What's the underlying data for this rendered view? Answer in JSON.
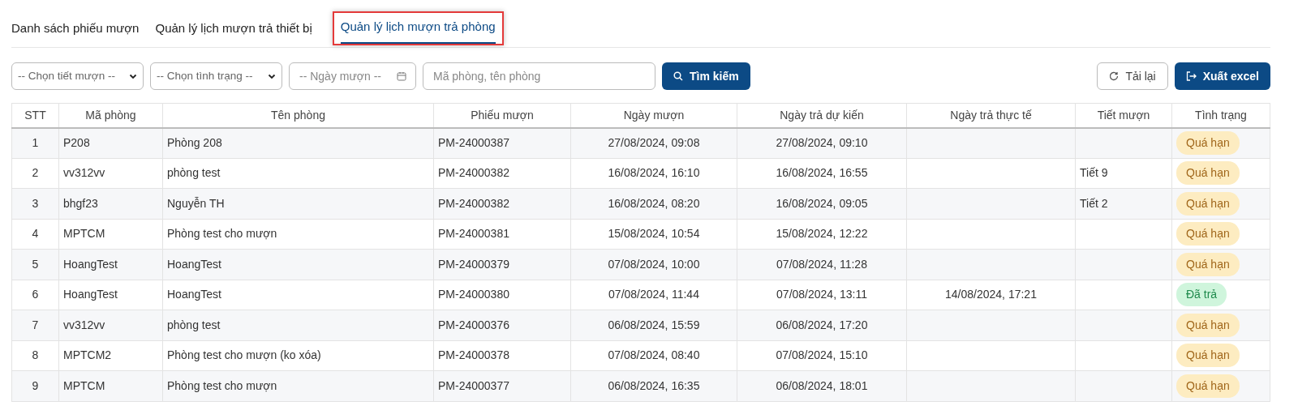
{
  "tabs": [
    {
      "label": "Danh sách phiếu mượn",
      "selected": false
    },
    {
      "label": "Quản lý lịch mượn trả thiết bị",
      "selected": false
    },
    {
      "label": "Quản lý lịch mượn trả phòng",
      "selected": true
    }
  ],
  "filters": {
    "period_select": "-- Chọn tiết mượn --",
    "status_select": "-- Chọn tình trạng --",
    "date_field": {
      "placeholder": "-- Ngày mượn --"
    },
    "search_field": {
      "placeholder": "Mã phòng, tên phòng"
    },
    "search_button": "Tìm kiếm"
  },
  "actions": {
    "reload_button": "Tải lại",
    "export_button": "Xuất excel"
  },
  "table": {
    "columns": [
      "STT",
      "Mã phòng",
      "Tên phòng",
      "Phiếu mượn",
      "Ngày mượn",
      "Ngày trả dự kiến",
      "Ngày trả thực tế",
      "Tiết mượn",
      "Tình trạng"
    ],
    "rows": [
      {
        "stt": "1",
        "code": "P208",
        "name": "Phòng 208",
        "ticket": "PM-24000387",
        "borrowed": "27/08/2024, 09:08",
        "due": "27/08/2024, 09:10",
        "returned": "",
        "period": "",
        "status": {
          "label": "Quá hạn",
          "kind": "overdue"
        }
      },
      {
        "stt": "2",
        "code": "vv312vv",
        "name": "phòng test",
        "ticket": "PM-24000382",
        "borrowed": "16/08/2024, 16:10",
        "due": "16/08/2024, 16:55",
        "returned": "",
        "period": "Tiết 9",
        "status": {
          "label": "Quá hạn",
          "kind": "overdue"
        }
      },
      {
        "stt": "3",
        "code": "bhgf23",
        "name": "Nguyễn TH",
        "ticket": "PM-24000382",
        "borrowed": "16/08/2024, 08:20",
        "due": "16/08/2024, 09:05",
        "returned": "",
        "period": "Tiết 2",
        "status": {
          "label": "Quá hạn",
          "kind": "overdue"
        }
      },
      {
        "stt": "4",
        "code": "MPTCM",
        "name": "Phòng test cho mượn",
        "ticket": "PM-24000381",
        "borrowed": "15/08/2024, 10:54",
        "due": "15/08/2024, 12:22",
        "returned": "",
        "period": "",
        "status": {
          "label": "Quá hạn",
          "kind": "overdue"
        }
      },
      {
        "stt": "5",
        "code": "HoangTest",
        "name": "HoangTest",
        "ticket": "PM-24000379",
        "borrowed": "07/08/2024, 10:00",
        "due": "07/08/2024, 11:28",
        "returned": "",
        "period": "",
        "status": {
          "label": "Quá hạn",
          "kind": "overdue"
        }
      },
      {
        "stt": "6",
        "code": "HoangTest",
        "name": "HoangTest",
        "ticket": "PM-24000380",
        "borrowed": "07/08/2024, 11:44",
        "due": "07/08/2024, 13:11",
        "returned": "14/08/2024, 17:21",
        "period": "",
        "status": {
          "label": "Đã trả",
          "kind": "returned"
        }
      },
      {
        "stt": "7",
        "code": "vv312vv",
        "name": "phòng test",
        "ticket": "PM-24000376",
        "borrowed": "06/08/2024, 15:59",
        "due": "06/08/2024, 17:20",
        "returned": "",
        "period": "",
        "status": {
          "label": "Quá hạn",
          "kind": "overdue"
        }
      },
      {
        "stt": "8",
        "code": "MPTCM2",
        "name": "Phòng test cho mượn (ko xóa)",
        "ticket": "PM-24000378",
        "borrowed": "07/08/2024, 08:40",
        "due": "07/08/2024, 15:10",
        "returned": "",
        "period": "",
        "status": {
          "label": "Quá hạn",
          "kind": "overdue"
        }
      },
      {
        "stt": "9",
        "code": "MPTCM",
        "name": "Phòng test cho mượn",
        "ticket": "PM-24000377",
        "borrowed": "06/08/2024, 16:35",
        "due": "06/08/2024, 18:01",
        "returned": "",
        "period": "",
        "status": {
          "label": "Quá hạn",
          "kind": "overdue"
        }
      }
    ]
  }
}
